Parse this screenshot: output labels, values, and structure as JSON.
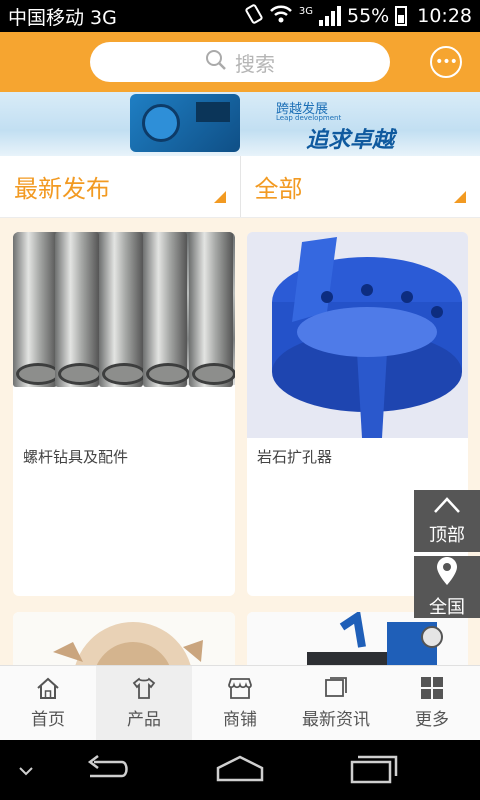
{
  "statusbar": {
    "carrier": "中国移动 3G",
    "network": "3G",
    "battery": "55%",
    "time": "10:28"
  },
  "search": {
    "placeholder": "搜索"
  },
  "banner": {
    "slogan_top": "跨越发展",
    "slogan_en": "Leap development",
    "slogan_main": "追求卓越"
  },
  "filters": {
    "left": "最新发布",
    "right": "全部"
  },
  "products": [
    {
      "title": "螺杆钻具及配件"
    },
    {
      "title": "岩石扩孔器"
    }
  ],
  "side": {
    "top_label": "顶部",
    "region_label": "全国"
  },
  "tabs": [
    {
      "label": "首页"
    },
    {
      "label": "产品"
    },
    {
      "label": "商铺"
    },
    {
      "label": "最新资讯"
    },
    {
      "label": "更多"
    }
  ],
  "active_tab": "产品",
  "colors": {
    "accent": "#f6a530",
    "accent_text": "#f29a22",
    "side_button": "#565656"
  }
}
